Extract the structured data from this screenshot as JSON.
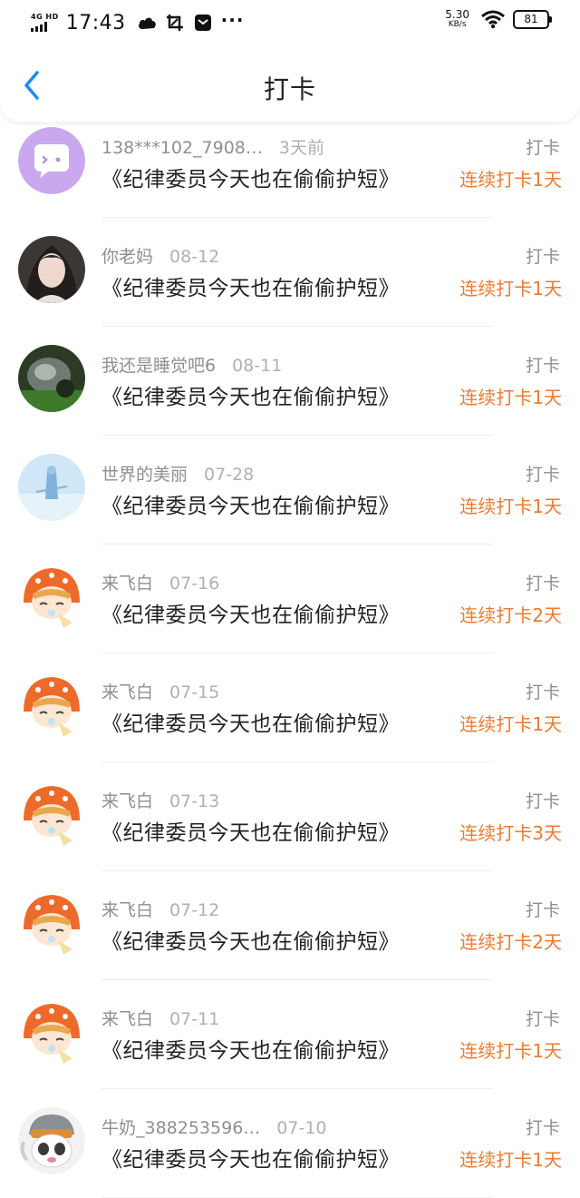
{
  "status_bar": {
    "network": "4G HD",
    "time": "17:43",
    "speed": "5.30",
    "speed_unit": "KB/s",
    "battery": "81"
  },
  "header": {
    "title": "打卡"
  },
  "colors": {
    "accent": "#1a8cff",
    "streak": "#f07a2e"
  },
  "entries": [
    {
      "name": "138***102_7908…",
      "time": "3天前",
      "book": "《纪律委员今天也在偷偷护短》",
      "tag": "打卡",
      "streak": "连续打卡1天",
      "avatar": "chat-bubble"
    },
    {
      "name": "你老妈",
      "time": "08-12",
      "book": "《纪律委员今天也在偷偷护短》",
      "tag": "打卡",
      "streak": "连续打卡1天",
      "avatar": "girl-photo"
    },
    {
      "name": "我还是睡觉吧6",
      "time": "08-11",
      "book": "《纪律委员今天也在偷偷护短》",
      "tag": "打卡",
      "streak": "连续打卡1天",
      "avatar": "dark-photo"
    },
    {
      "name": "世界的美丽",
      "time": "07-28",
      "book": "《纪律委员今天也在偷偷护短》",
      "tag": "打卡",
      "streak": "连续打卡1天",
      "avatar": "sky-photo"
    },
    {
      "name": "来飞白",
      "time": "07-16",
      "book": "《纪律委员今天也在偷偷护短》",
      "tag": "打卡",
      "streak": "连续打卡2天",
      "avatar": "anime-hood"
    },
    {
      "name": "来飞白",
      "time": "07-15",
      "book": "《纪律委员今天也在偷偷护短》",
      "tag": "打卡",
      "streak": "连续打卡1天",
      "avatar": "anime-hood"
    },
    {
      "name": "来飞白",
      "time": "07-13",
      "book": "《纪律委员今天也在偷偷护短》",
      "tag": "打卡",
      "streak": "连续打卡3天",
      "avatar": "anime-hood"
    },
    {
      "name": "来飞白",
      "time": "07-12",
      "book": "《纪律委员今天也在偷偷护短》",
      "tag": "打卡",
      "streak": "连续打卡2天",
      "avatar": "anime-hood"
    },
    {
      "name": "来飞白",
      "time": "07-11",
      "book": "《纪律委员今天也在偷偷护短》",
      "tag": "打卡",
      "streak": "连续打卡1天",
      "avatar": "anime-hood"
    },
    {
      "name": "牛奶_388253596…",
      "time": "07-10",
      "book": "《纪律委员今天也在偷偷护短》",
      "tag": "打卡",
      "streak": "连续打卡1天",
      "avatar": "cartoon-goat"
    }
  ]
}
